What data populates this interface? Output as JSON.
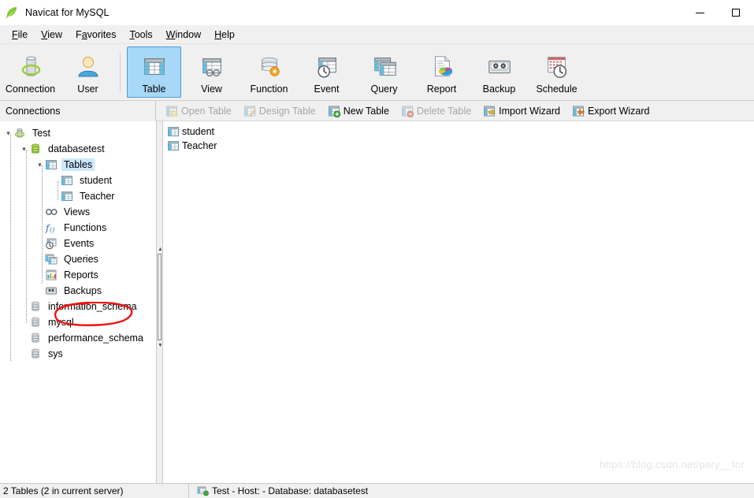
{
  "window": {
    "title": "Navicat for MySQL",
    "logo_icon": "navicat-leaf-icon",
    "controls": [
      {
        "name": "minimize",
        "icon": "minimize-icon"
      },
      {
        "name": "maximize",
        "icon": "maximize-icon"
      }
    ]
  },
  "menubar": {
    "items": [
      {
        "label": "File",
        "accel": "F"
      },
      {
        "label": "View",
        "accel": "V"
      },
      {
        "label": "Favorites",
        "accel": "a"
      },
      {
        "label": "Tools",
        "accel": "T"
      },
      {
        "label": "Window",
        "accel": "W"
      },
      {
        "label": "Help",
        "accel": "H"
      }
    ]
  },
  "toolbar": {
    "buttons": [
      {
        "label": "Connection",
        "icon": "connection-icon",
        "active": false
      },
      {
        "label": "User",
        "icon": "user-icon",
        "active": false
      },
      {
        "label": "Table",
        "icon": "table-icon",
        "active": true
      },
      {
        "label": "View",
        "icon": "view-icon",
        "active": false
      },
      {
        "label": "Function",
        "icon": "function-icon",
        "active": false
      },
      {
        "label": "Event",
        "icon": "event-icon",
        "active": false
      },
      {
        "label": "Query",
        "icon": "query-icon",
        "active": false
      },
      {
        "label": "Report",
        "icon": "report-icon",
        "active": false
      },
      {
        "label": "Backup",
        "icon": "backup-icon",
        "active": false
      },
      {
        "label": "Schedule",
        "icon": "schedule-icon",
        "active": false
      }
    ]
  },
  "sidebar": {
    "header": "Connections",
    "tree": [
      {
        "label": "Test",
        "icon": "connection-node-icon",
        "level": 0,
        "expanded": true,
        "selected": false
      },
      {
        "label": "databasetest",
        "icon": "database-icon",
        "level": 1,
        "expanded": true,
        "selected": false
      },
      {
        "label": "Tables",
        "icon": "tables-folder-icon",
        "level": 2,
        "expanded": true,
        "selected": true
      },
      {
        "label": "student",
        "icon": "table-item-icon",
        "level": 3,
        "expanded": null,
        "selected": false
      },
      {
        "label": "Teacher",
        "icon": "table-item-icon",
        "level": 3,
        "expanded": null,
        "selected": false,
        "annotated": true
      },
      {
        "label": "Views",
        "icon": "views-icon",
        "level": 2,
        "expanded": null,
        "selected": false
      },
      {
        "label": "Functions",
        "icon": "functions-icon",
        "level": 2,
        "expanded": null,
        "selected": false
      },
      {
        "label": "Events",
        "icon": "events-icon",
        "level": 2,
        "expanded": null,
        "selected": false
      },
      {
        "label": "Queries",
        "icon": "queries-icon",
        "level": 2,
        "expanded": null,
        "selected": false
      },
      {
        "label": "Reports",
        "icon": "reports-icon",
        "level": 2,
        "expanded": null,
        "selected": false
      },
      {
        "label": "Backups",
        "icon": "backups-icon",
        "level": 2,
        "expanded": null,
        "selected": false
      },
      {
        "label": "information_schema",
        "icon": "database-icon",
        "level": 1,
        "expanded": null,
        "selected": false
      },
      {
        "label": "mysql",
        "icon": "database-icon",
        "level": 1,
        "expanded": null,
        "selected": false
      },
      {
        "label": "performance_schema",
        "icon": "database-icon",
        "level": 1,
        "expanded": null,
        "selected": false
      },
      {
        "label": "sys",
        "icon": "database-icon",
        "level": 1,
        "expanded": null,
        "selected": false
      }
    ]
  },
  "object_toolbar": {
    "buttons": [
      {
        "label": "Open Table",
        "icon": "open-table-icon",
        "disabled": true
      },
      {
        "label": "Design Table",
        "icon": "design-table-icon",
        "disabled": true
      },
      {
        "label": "New Table",
        "icon": "new-table-icon",
        "disabled": false
      },
      {
        "label": "Delete Table",
        "icon": "delete-table-icon",
        "disabled": true
      },
      {
        "label": "Import Wizard",
        "icon": "import-wizard-icon",
        "disabled": false
      },
      {
        "label": "Export Wizard",
        "icon": "export-wizard-icon",
        "disabled": false
      }
    ]
  },
  "content": {
    "objects": [
      {
        "label": "student",
        "icon": "table-item-icon"
      },
      {
        "label": "Teacher",
        "icon": "table-item-icon"
      }
    ]
  },
  "statusbar": {
    "left": "2 Tables (2 in current server)",
    "right": "Test - Host: - Database: databasetest",
    "right_icon": "server-icon"
  },
  "watermark": {
    "text": "https://blog.csdn.net/pary__for"
  },
  "colors": {
    "accent": "#a8d8f8",
    "accent_border": "#4a9ad4",
    "selection": "#cce8ff",
    "annotation": "#ee1111",
    "chrome": "#f0f0f0",
    "disabled_text": "#a6a6a6"
  }
}
